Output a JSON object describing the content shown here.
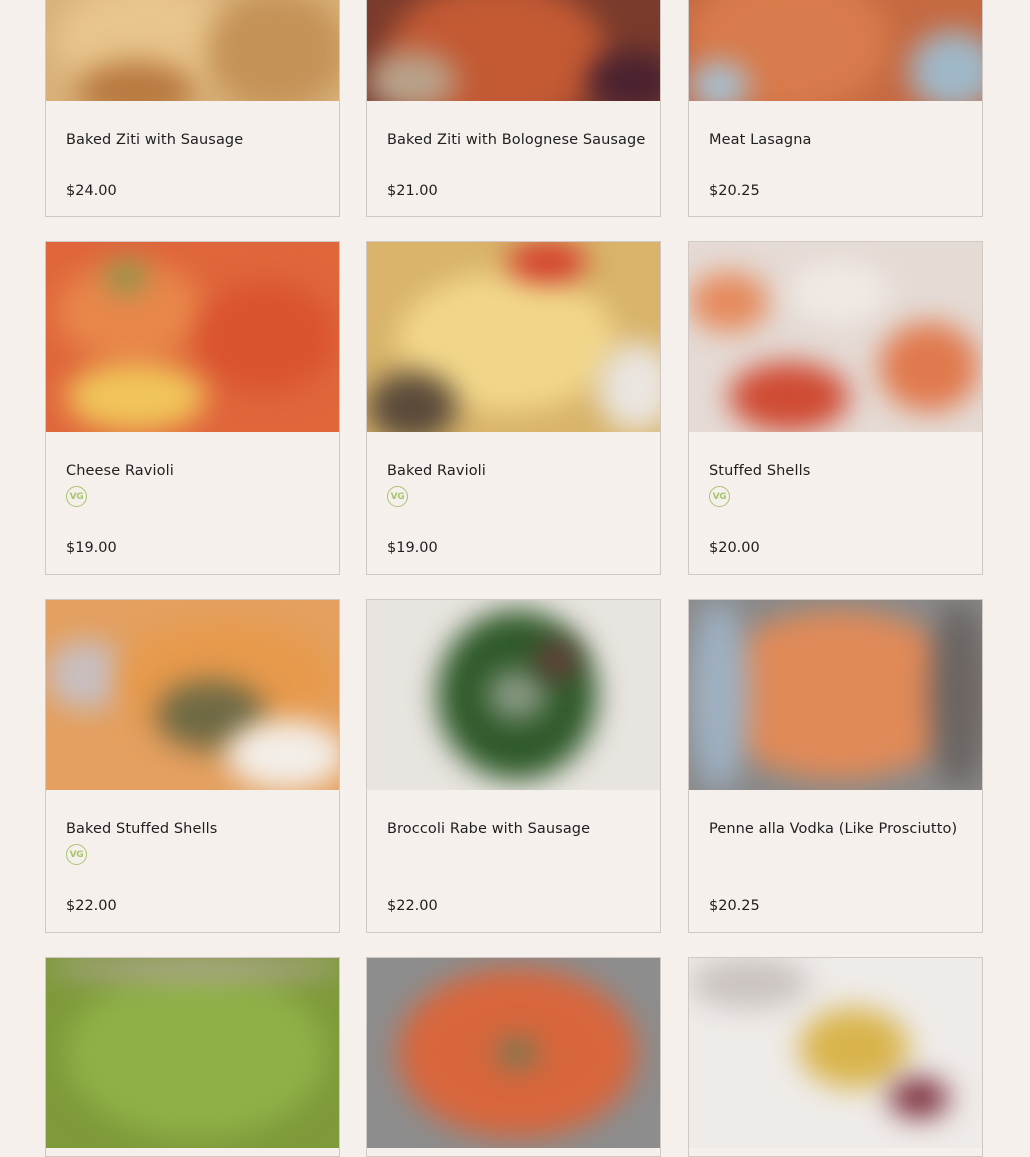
{
  "menu": {
    "items": [
      {
        "name": "Baked Ziti with Sausage",
        "price": "$24.00",
        "vegetarian": false,
        "image": "baked-ziti-photo"
      },
      {
        "name": "Baked Ziti with Bolognese Sausage",
        "price": "$21.00",
        "vegetarian": false,
        "image": "bolognese-ziti-photo"
      },
      {
        "name": "Meat Lasagna",
        "price": "$20.25",
        "vegetarian": false,
        "image": "lasagna-photo"
      },
      {
        "name": "Cheese Ravioli",
        "price": "$19.00",
        "vegetarian": true,
        "badge": "VG",
        "image": "cheese-ravioli-photo"
      },
      {
        "name": "Baked Ravioli",
        "price": "$19.00",
        "vegetarian": true,
        "badge": "VG",
        "image": "baked-ravioli-photo"
      },
      {
        "name": "Stuffed Shells",
        "price": "$20.00",
        "vegetarian": true,
        "badge": "VG",
        "image": "stuffed-shells-photo"
      },
      {
        "name": "Baked Stuffed Shells",
        "price": "$22.00",
        "vegetarian": true,
        "badge": "VG",
        "image": "baked-stuffed-shells-photo"
      },
      {
        "name": "Broccoli Rabe with Sausage",
        "price": "$22.00",
        "vegetarian": false,
        "image": "broccoli-rabe-photo"
      },
      {
        "name": "Penne alla Vodka (Like Prosciutto)",
        "price": "$20.25",
        "vegetarian": false,
        "image": "penne-vodka-photo"
      },
      {
        "image": "pesto-pasta-photo"
      },
      {
        "image": "red-pasta-photo"
      },
      {
        "image": "plated-pasta-photo"
      }
    ]
  },
  "colors": {
    "background": "#f6f0ec",
    "card_border": "#cfc8c4",
    "vegetarian_badge": "#a9c46e",
    "text": "#1f1f1f"
  }
}
